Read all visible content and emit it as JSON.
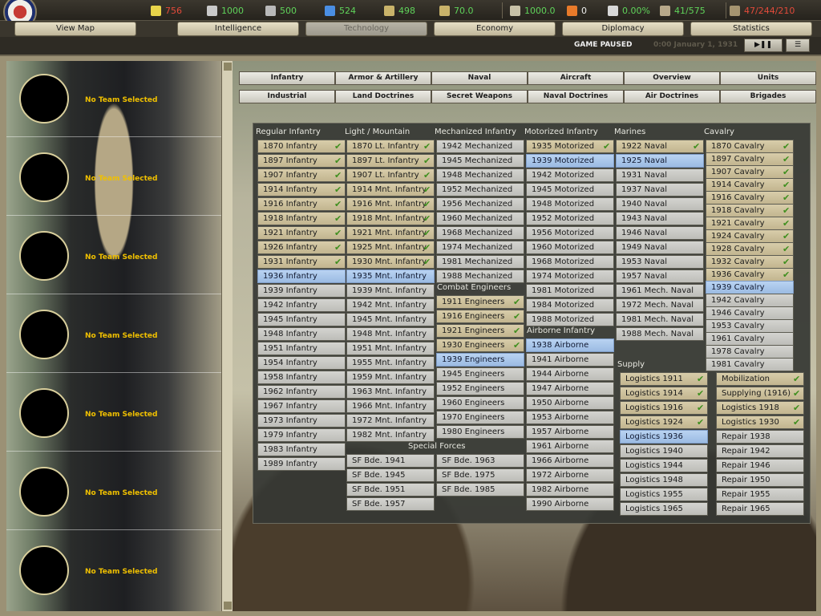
{
  "resources": [
    {
      "name": "energy",
      "icon": "lightning-icon",
      "value": "756",
      "color": "#e34a3a"
    },
    {
      "name": "metal",
      "icon": "metal-bars-icon",
      "value": "1000",
      "color": "#5fd35a"
    },
    {
      "name": "rares",
      "icon": "rare-materials-icon",
      "value": "500",
      "color": "#5fd35a"
    },
    {
      "name": "oil",
      "icon": "oil-drop-icon",
      "value": "524",
      "color": "#5fd35a"
    },
    {
      "name": "supplies",
      "icon": "supplies-icon",
      "value": "498",
      "color": "#5fd35a"
    },
    {
      "name": "money",
      "icon": "money-icon",
      "value": "70.0",
      "color": "#5fd35a"
    },
    {
      "name": "ic",
      "icon": "industry-icon",
      "value": "1000.0",
      "color": "#5fd35a"
    },
    {
      "name": "dissent",
      "icon": "dissent-icon",
      "value": "0",
      "color": "#eeeeee"
    },
    {
      "name": "nuke",
      "icon": "nuclear-icon",
      "value": "0.00%",
      "color": "#5fd35a"
    },
    {
      "name": "transports",
      "icon": "transport-icon",
      "value": "41/575",
      "color": "#5fd35a"
    },
    {
      "name": "manpower",
      "icon": "manpower-icon",
      "value": "47/244/210",
      "color": "#e34a3a"
    }
  ],
  "main_tabs": [
    "View Map",
    "Intelligence",
    "Technology",
    "Economy",
    "Diplomacy",
    "Statistics"
  ],
  "status": {
    "paused": "GAME PAUSED",
    "date": "0:00 January 1, 1931",
    "play_pause": "▶❚❚",
    "menu": "☰"
  },
  "teams": {
    "label": "No Team Selected"
  },
  "categories_row1": [
    "Infantry",
    "Armor & Artillery",
    "Naval",
    "Aircraft",
    "Overview",
    "Units"
  ],
  "categories_row2": [
    "Industrial",
    "Land Doctrines",
    "Secret Weapons",
    "Naval Doctrines",
    "Air Doctrines",
    "Brigades"
  ],
  "tech": {
    "regular_infantry": {
      "title": "Regular Infantry",
      "items": [
        {
          "t": "1870 Infantry",
          "s": "done"
        },
        {
          "t": "1897 Infantry",
          "s": "done"
        },
        {
          "t": "1907 Infantry",
          "s": "done"
        },
        {
          "t": "1914 Infantry",
          "s": "done"
        },
        {
          "t": "1916 Infantry",
          "s": "done"
        },
        {
          "t": "1918 Infantry",
          "s": "done"
        },
        {
          "t": "1921 Infantry",
          "s": "done"
        },
        {
          "t": "1926 Infantry",
          "s": "done"
        },
        {
          "t": "1931 Infantry",
          "s": "done"
        },
        {
          "t": "1936 Infantry",
          "s": "cur"
        },
        {
          "t": "1939 Infantry",
          "s": "todo"
        },
        {
          "t": "1942 Infantry",
          "s": "todo"
        },
        {
          "t": "1945 Infantry",
          "s": "todo"
        },
        {
          "t": "1948 Infantry",
          "s": "todo"
        },
        {
          "t": "1951 Infantry",
          "s": "todo"
        },
        {
          "t": "1954 Infantry",
          "s": "todo"
        },
        {
          "t": "1958 Infantry",
          "s": "todo"
        },
        {
          "t": "1962 Infantry",
          "s": "todo"
        },
        {
          "t": "1967 Infantry",
          "s": "todo"
        },
        {
          "t": "1973 Infantry",
          "s": "todo"
        },
        {
          "t": "1979 Infantry",
          "s": "todo"
        },
        {
          "t": "1983 Infantry",
          "s": "todo"
        },
        {
          "t": "1989 Infantry",
          "s": "todo"
        }
      ]
    },
    "light_mountain": {
      "title": "Light / Mountain",
      "items": [
        {
          "t": "1870 Lt. Infantry",
          "s": "done"
        },
        {
          "t": "1897 Lt. Infantry",
          "s": "done"
        },
        {
          "t": "1907 Lt. Infantry",
          "s": "done"
        },
        {
          "t": "1914 Mnt. Infantry",
          "s": "done"
        },
        {
          "t": "1916 Mnt. Infantry",
          "s": "done"
        },
        {
          "t": "1918 Mnt. Infantry",
          "s": "done"
        },
        {
          "t": "1921 Mnt. Infantry",
          "s": "done"
        },
        {
          "t": "1925 Mnt. Infantry",
          "s": "done"
        },
        {
          "t": "1930 Mnt. Infantry",
          "s": "done"
        },
        {
          "t": "1935 Mnt. Infantry",
          "s": "cur"
        },
        {
          "t": "1939 Mnt. Infantry",
          "s": "todo"
        },
        {
          "t": "1942 Mnt. Infantry",
          "s": "todo"
        },
        {
          "t": "1945 Mnt. Infantry",
          "s": "todo"
        },
        {
          "t": "1948 Mnt. Infantry",
          "s": "todo"
        },
        {
          "t": "1951 Mnt. Infantry",
          "s": "todo"
        },
        {
          "t": "1955 Mnt. Infantry",
          "s": "todo"
        },
        {
          "t": "1959 Mnt. Infantry",
          "s": "todo"
        },
        {
          "t": "1963 Mnt. Infantry",
          "s": "todo"
        },
        {
          "t": "1966 Mnt. Infantry",
          "s": "todo"
        },
        {
          "t": "1972 Mnt. Infantry",
          "s": "todo"
        },
        {
          "t": "1982 Mnt. Infantry",
          "s": "todo"
        }
      ]
    },
    "special_forces": {
      "title": "Special Forces",
      "items": [
        {
          "t": "SF Bde. 1941",
          "s": "todo"
        },
        {
          "t": "SF Bde. 1963",
          "s": "todo"
        },
        {
          "t": "SF Bde. 1945",
          "s": "todo"
        },
        {
          "t": "SF Bde. 1975",
          "s": "todo"
        },
        {
          "t": "SF Bde. 1951",
          "s": "todo"
        },
        {
          "t": "SF Bde. 1985",
          "s": "todo"
        },
        {
          "t": "SF Bde. 1957",
          "s": "todo"
        }
      ]
    },
    "mechanized": {
      "title": "Mechanized Infantry",
      "items": [
        {
          "t": "1942 Mechanized",
          "s": "todo"
        },
        {
          "t": "1945 Mechanized",
          "s": "todo"
        },
        {
          "t": "1948 Mechanized",
          "s": "todo"
        },
        {
          "t": "1952 Mechanized",
          "s": "todo"
        },
        {
          "t": "1956 Mechanized",
          "s": "todo"
        },
        {
          "t": "1960 Mechanized",
          "s": "todo"
        },
        {
          "t": "1968 Mechanized",
          "s": "todo"
        },
        {
          "t": "1974 Mechanized",
          "s": "todo"
        },
        {
          "t": "1981 Mechanized",
          "s": "todo"
        },
        {
          "t": "1988 Mechanized",
          "s": "todo"
        }
      ]
    },
    "engineers": {
      "title": "Combat Engineers",
      "items": [
        {
          "t": "1911 Engineers",
          "s": "done"
        },
        {
          "t": "1916 Engineers",
          "s": "done"
        },
        {
          "t": "1921 Engineers",
          "s": "done"
        },
        {
          "t": "1930 Engineers",
          "s": "done"
        },
        {
          "t": "1939 Engineers",
          "s": "cur"
        },
        {
          "t": "1945 Engineers",
          "s": "todo"
        },
        {
          "t": "1952 Engineers",
          "s": "todo"
        },
        {
          "t": "1960 Engineers",
          "s": "todo"
        },
        {
          "t": "1970 Engineers",
          "s": "todo"
        },
        {
          "t": "1980 Engineers",
          "s": "todo"
        }
      ]
    },
    "motorized": {
      "title": "Motorized Infantry",
      "items": [
        {
          "t": "1935 Motorized",
          "s": "done"
        },
        {
          "t": "1939 Motorized",
          "s": "cur"
        },
        {
          "t": "1942 Motorized",
          "s": "todo"
        },
        {
          "t": "1945 Motorized",
          "s": "todo"
        },
        {
          "t": "1948 Motorized",
          "s": "todo"
        },
        {
          "t": "1952 Motorized",
          "s": "todo"
        },
        {
          "t": "1956 Motorized",
          "s": "todo"
        },
        {
          "t": "1960 Motorized",
          "s": "todo"
        },
        {
          "t": "1968 Motorized",
          "s": "todo"
        },
        {
          "t": "1974 Motorized",
          "s": "todo"
        },
        {
          "t": "1981 Motorized",
          "s": "todo"
        },
        {
          "t": "1984 Motorized",
          "s": "todo"
        },
        {
          "t": "1988 Motorized",
          "s": "todo"
        }
      ]
    },
    "airborne": {
      "title": "Airborne Infantry",
      "items": [
        {
          "t": "1938 Airborne",
          "s": "cur"
        },
        {
          "t": "1941 Airborne",
          "s": "todo"
        },
        {
          "t": "1944 Airborne",
          "s": "todo"
        },
        {
          "t": "1947 Airborne",
          "s": "todo"
        },
        {
          "t": "1950 Airborne",
          "s": "todo"
        },
        {
          "t": "1953 Airborne",
          "s": "todo"
        },
        {
          "t": "1957 Airborne",
          "s": "todo"
        },
        {
          "t": "1961 Airborne",
          "s": "todo"
        },
        {
          "t": "1966 Airborne",
          "s": "todo"
        },
        {
          "t": "1972 Airborne",
          "s": "todo"
        },
        {
          "t": "1982 Airborne",
          "s": "todo"
        },
        {
          "t": "1990 Airborne",
          "s": "todo"
        }
      ]
    },
    "marines": {
      "title": "Marines",
      "items": [
        {
          "t": "1922 Naval",
          "s": "done"
        },
        {
          "t": "1925 Naval",
          "s": "cur"
        },
        {
          "t": "1931 Naval",
          "s": "todo"
        },
        {
          "t": "1937 Naval",
          "s": "todo"
        },
        {
          "t": "1940 Naval",
          "s": "todo"
        },
        {
          "t": "1943 Naval",
          "s": "todo"
        },
        {
          "t": "1946 Naval",
          "s": "todo"
        },
        {
          "t": "1949 Naval",
          "s": "todo"
        },
        {
          "t": "1953 Naval",
          "s": "todo"
        },
        {
          "t": "1957 Naval",
          "s": "todo"
        },
        {
          "t": "1961 Mech. Naval",
          "s": "todo"
        },
        {
          "t": "1972 Mech. Naval",
          "s": "todo"
        },
        {
          "t": "1981 Mech. Naval",
          "s": "todo"
        },
        {
          "t": "1988 Mech. Naval",
          "s": "todo"
        }
      ]
    },
    "supply": {
      "title": "Supply",
      "items": [
        {
          "t": "Logistics 1911",
          "s": "done"
        },
        {
          "t": "Logistics 1914",
          "s": "done"
        },
        {
          "t": "Logistics 1916",
          "s": "done"
        },
        {
          "t": "Logistics 1924",
          "s": "done"
        },
        {
          "t": "Logistics 1936",
          "s": "cur"
        },
        {
          "t": "Logistics 1940",
          "s": "todo"
        },
        {
          "t": "Logistics 1944",
          "s": "todo"
        },
        {
          "t": "Logistics 1948",
          "s": "todo"
        },
        {
          "t": "Logistics 1955",
          "s": "todo"
        },
        {
          "t": "Logistics 1965",
          "s": "todo"
        }
      ]
    },
    "cavalry": {
      "title": "Cavalry",
      "items": [
        {
          "t": "1870 Cavalry",
          "s": "done"
        },
        {
          "t": "1897 Cavalry",
          "s": "done"
        },
        {
          "t": "1907 Cavalry",
          "s": "done"
        },
        {
          "t": "1914 Cavalry",
          "s": "done"
        },
        {
          "t": "1916 Cavalry",
          "s": "done"
        },
        {
          "t": "1918 Cavalry",
          "s": "done"
        },
        {
          "t": "1921 Cavalry",
          "s": "done"
        },
        {
          "t": "1924 Cavalry",
          "s": "done"
        },
        {
          "t": "1928 Cavalry",
          "s": "done"
        },
        {
          "t": "1932 Cavalry",
          "s": "done"
        },
        {
          "t": "1936 Cavalry",
          "s": "done"
        },
        {
          "t": "1939 Cavalry",
          "s": "cur"
        },
        {
          "t": "1942 Cavalry",
          "s": "todo"
        },
        {
          "t": "1946 Cavalry",
          "s": "todo"
        },
        {
          "t": "1953 Cavalry",
          "s": "todo"
        },
        {
          "t": "1961 Cavalry",
          "s": "todo"
        },
        {
          "t": "1978 Cavalry",
          "s": "todo"
        },
        {
          "t": "1981 Cavalry",
          "s": "todo"
        }
      ]
    },
    "supply2": {
      "items": [
        {
          "t": "Mobilization",
          "s": "done"
        },
        {
          "t": "Supplying (1916)",
          "s": "done"
        },
        {
          "t": "Logistics 1918",
          "s": "done"
        },
        {
          "t": "Logistics 1930",
          "s": "done"
        },
        {
          "t": "Repair 1938",
          "s": "todo"
        },
        {
          "t": "Repair 1942",
          "s": "todo"
        },
        {
          "t": "Repair 1946",
          "s": "todo"
        },
        {
          "t": "Repair 1950",
          "s": "todo"
        },
        {
          "t": "Repair 1955",
          "s": "todo"
        },
        {
          "t": "Repair 1965",
          "s": "todo"
        }
      ]
    }
  }
}
